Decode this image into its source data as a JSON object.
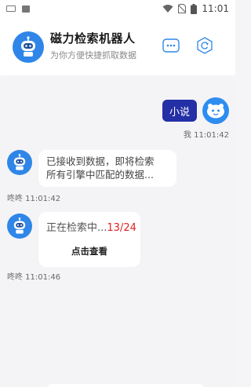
{
  "status_bar": {
    "time": "11:01",
    "icons": [
      "keyboard-icon",
      "image-icon",
      "wifi-icon",
      "no-sim-icon",
      "battery-icon"
    ]
  },
  "header": {
    "title": "磁力检索机器人",
    "subtitle": "为你方便快捷抓取数据",
    "more_icon": "ellipsis-icon",
    "refresh_icon": "refresh-icon"
  },
  "chat": {
    "messages": [
      {
        "sender": "user",
        "text": "小说",
        "time": "我 11:01:42"
      },
      {
        "sender": "bot",
        "line1": "已接收到数据，即将检索",
        "line2": "所有引擎中匹配的数据...",
        "time": "咚咚 11:01:42"
      },
      {
        "sender": "bot",
        "progress_text": "正在检索中...",
        "progress_count": "13/24",
        "button_label": "点击查看",
        "time": "咚咚 11:01:46"
      }
    ]
  },
  "colors": {
    "accent": "#2f86e8",
    "user_bubble": "#2430a6",
    "count_red": "#e02020",
    "background": "#f4f4f6"
  }
}
